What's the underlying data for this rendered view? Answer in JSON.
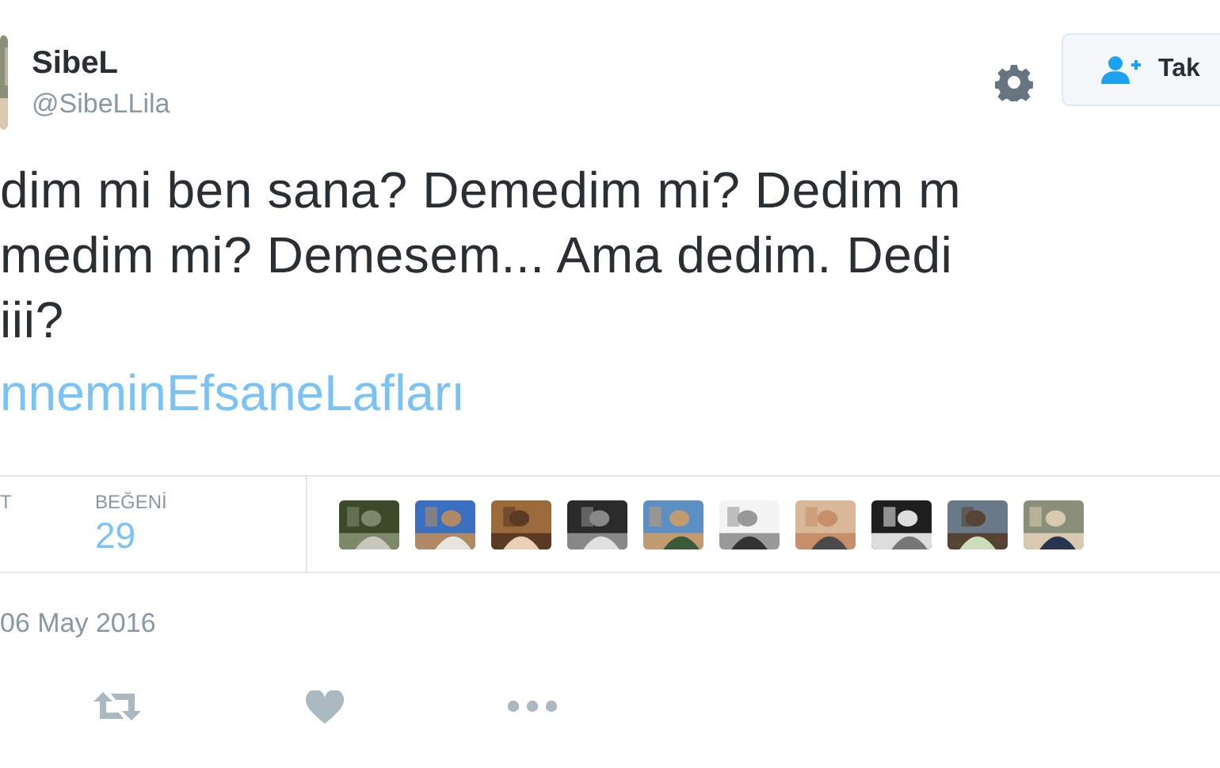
{
  "author": {
    "name": "SibeL",
    "handle": "@SibeLLila"
  },
  "follow_button": {
    "label": "Tak"
  },
  "text_lines": [
    "dim mi ben sana? Demedim mi? Dedim m",
    "medim mi? Demesem... Ama dedim. Dedi",
    "iii?"
  ],
  "hashtag": "nneminEfsaneLafları",
  "stats": [
    {
      "label": "T"
    },
    {
      "label": "BEĞENİ",
      "value": "29"
    }
  ],
  "date": "06 May 2016",
  "actions": [
    {
      "kind": "retweet"
    },
    {
      "kind": "like"
    },
    {
      "kind": "more"
    }
  ]
}
